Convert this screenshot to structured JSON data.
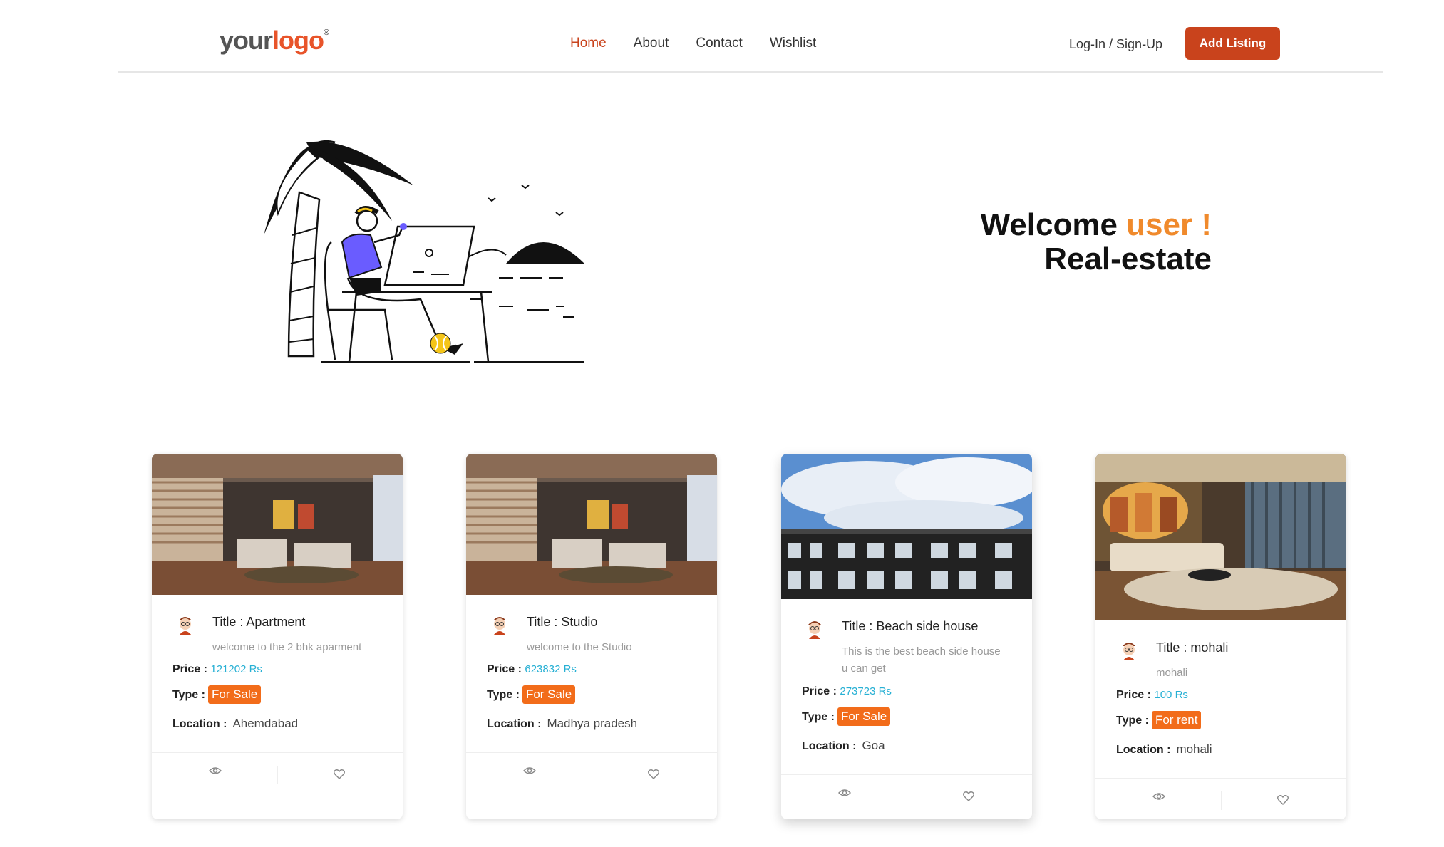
{
  "header": {
    "logo_your": "your",
    "logo_logo": "logo",
    "logo_reg": "®",
    "nav": [
      {
        "label": "Home",
        "active": true
      },
      {
        "label": "About",
        "active": false
      },
      {
        "label": "Contact",
        "active": false
      },
      {
        "label": "Wishlist",
        "active": false
      }
    ],
    "login_label": "Log-In / Sign-Up",
    "add_listing_label": "Add Listing"
  },
  "hero": {
    "welcome": "Welcome",
    "user": "user !",
    "subtitle": "Real-estate"
  },
  "labels": {
    "price": "Price :",
    "type": "Type :",
    "location": "Location :"
  },
  "cards": [
    {
      "title": "Title : Apartment",
      "description": "welcome to the 2 bhk aparment",
      "price": "121202 Rs",
      "type": "For Sale",
      "location": "Ahemdabad",
      "image": "living-room"
    },
    {
      "title": "Title : Studio",
      "description": "welcome to the Studio",
      "price": "623832 Rs",
      "type": "For Sale",
      "location": "Madhya pradesh",
      "image": "living-room"
    },
    {
      "title": "Title : Beach side house",
      "description": "This is the best beach side house u can get",
      "price": "273723 Rs",
      "type": "For Sale",
      "location": "Goa",
      "image": "building"
    },
    {
      "title": "Title : mohali",
      "description": "mohali",
      "price": "100 Rs",
      "type": "For rent",
      "location": "mohali",
      "image": "lounge"
    }
  ],
  "colors": {
    "brand": "#c9431c",
    "accent": "#f08a2c",
    "price": "#27b0d4",
    "badge": "#f26c1a"
  }
}
